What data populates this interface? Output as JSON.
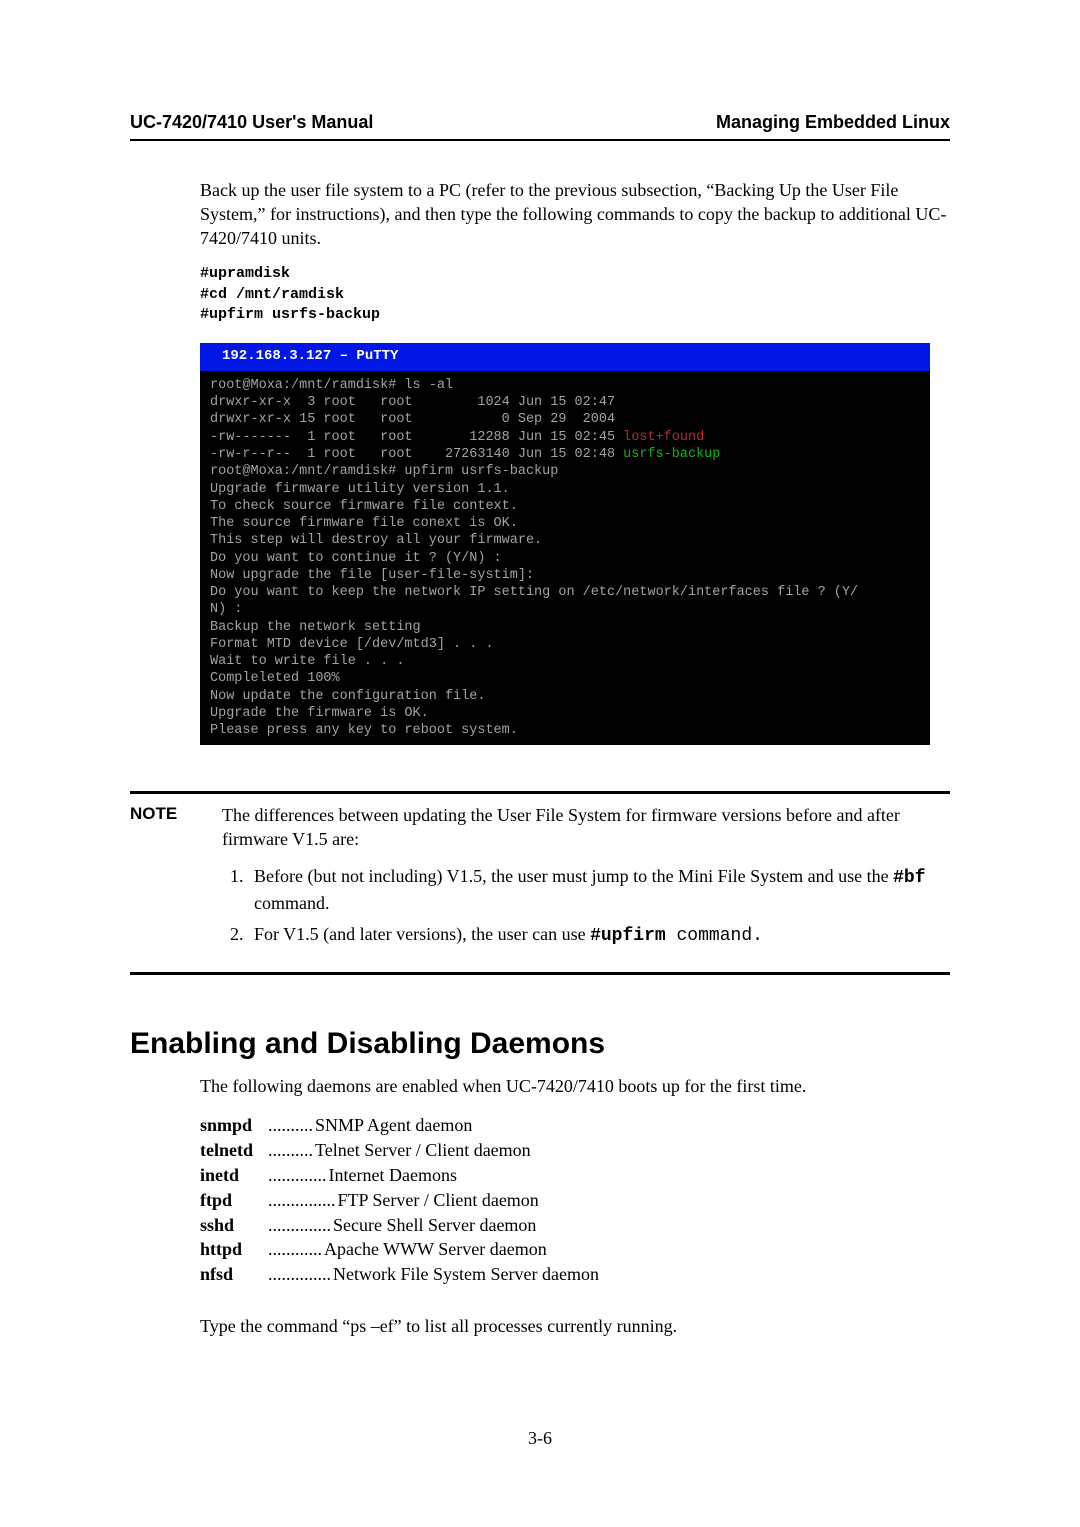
{
  "header": {
    "left": "UC-7420/7410 User's Manual",
    "right": "Managing Embedded Linux"
  },
  "intro_para": "Back up the user file system to a PC (refer to the previous subsection, “Backing Up the User File System,” for instructions), and then type the following commands to copy the backup to additional UC-7420/7410 units.",
  "cmds": "#upramdisk\n#cd /mnt/ramdisk\n#upfirm usrfs-backup",
  "term_title": "  192.168.3.127 – PuTTY",
  "term_lines": [
    {
      "t": "root@Moxa:/mnt/ramdisk# ls -al"
    },
    {
      "t": "drwxr-xr-x  3 root   root        1024 Jun 15 02:47"
    },
    {
      "t": "drwxr-xr-x 15 root   root           0 Sep 29  2004"
    },
    {
      "t": "-rw-------  1 root   root       12288 Jun 15 02:45 ",
      "a": "lost+found"
    },
    {
      "t": "-rw-r--r--  1 root   root    27263140 Jun 15 02:48 ",
      "b": "usrfs-backup"
    },
    {
      "t": "root@Moxa:/mnt/ramdisk# upfirm usrfs-backup"
    },
    {
      "t": "Upgrade firmware utility version 1.1."
    },
    {
      "t": "To check source firmware file context."
    },
    {
      "t": "The source firmware file conext is OK."
    },
    {
      "t": "This step will destroy all your firmware."
    },
    {
      "t": "Do you want to continue it ? (Y/N) :"
    },
    {
      "t": "Now upgrade the file [user-file-systim]:"
    },
    {
      "t": "Do you want to keep the network IP setting on /etc/network/interfaces file ? (Y/"
    },
    {
      "t": "N) :"
    },
    {
      "t": "Backup the network setting"
    },
    {
      "t": "Format MTD device [/dev/mtd3] . . ."
    },
    {
      "t": "Wait to write file . . ."
    },
    {
      "t": "Compleleted 100%"
    },
    {
      "t": "Now update the configuration file."
    },
    {
      "t": "Upgrade the firmware is OK."
    },
    {
      "t": "Please press any key to reboot system."
    }
  ],
  "note": {
    "label": "NOTE",
    "lead": "The differences between updating the User File System for firmware versions before and after firmware V1.5 are:",
    "items": [
      {
        "pre": "Before (but not including) V1.5, the user must jump to the Mini File System and use the ",
        "code": "#bf",
        "post": " command."
      },
      {
        "pre": "For V1.5 (and later versions), the user can use ",
        "code": "#upfirm",
        "mono": " command.",
        "post": ""
      }
    ]
  },
  "section_heading": "Enabling and Disabling Daemons",
  "section_para": "The following daemons are enabled when UC-7420/7410 boots up for the first time.",
  "daemons": [
    {
      "name": "snmpd",
      "dots": " ..........",
      "desc": "SNMP Agent daemon"
    },
    {
      "name": "telnetd",
      "dots": " ..........",
      "desc": "Telnet Server / Client daemon"
    },
    {
      "name": "inetd",
      "dots": " .............",
      "desc": "Internet Daemons"
    },
    {
      "name": "ftpd",
      "dots": "...............",
      "desc": "FTP Server / Client daemon"
    },
    {
      "name": "sshd",
      "dots": " ..............",
      "desc": "Secure Shell Server daemon"
    },
    {
      "name": "httpd",
      "dots": " ............",
      "desc": "Apache WWW Server daemon"
    },
    {
      "name": "nfsd",
      "dots": " ..............",
      "desc": "Network File System Server daemon"
    }
  ],
  "final_para": "Type the command “ps –ef” to list all processes currently running.",
  "page_num": "3-6"
}
